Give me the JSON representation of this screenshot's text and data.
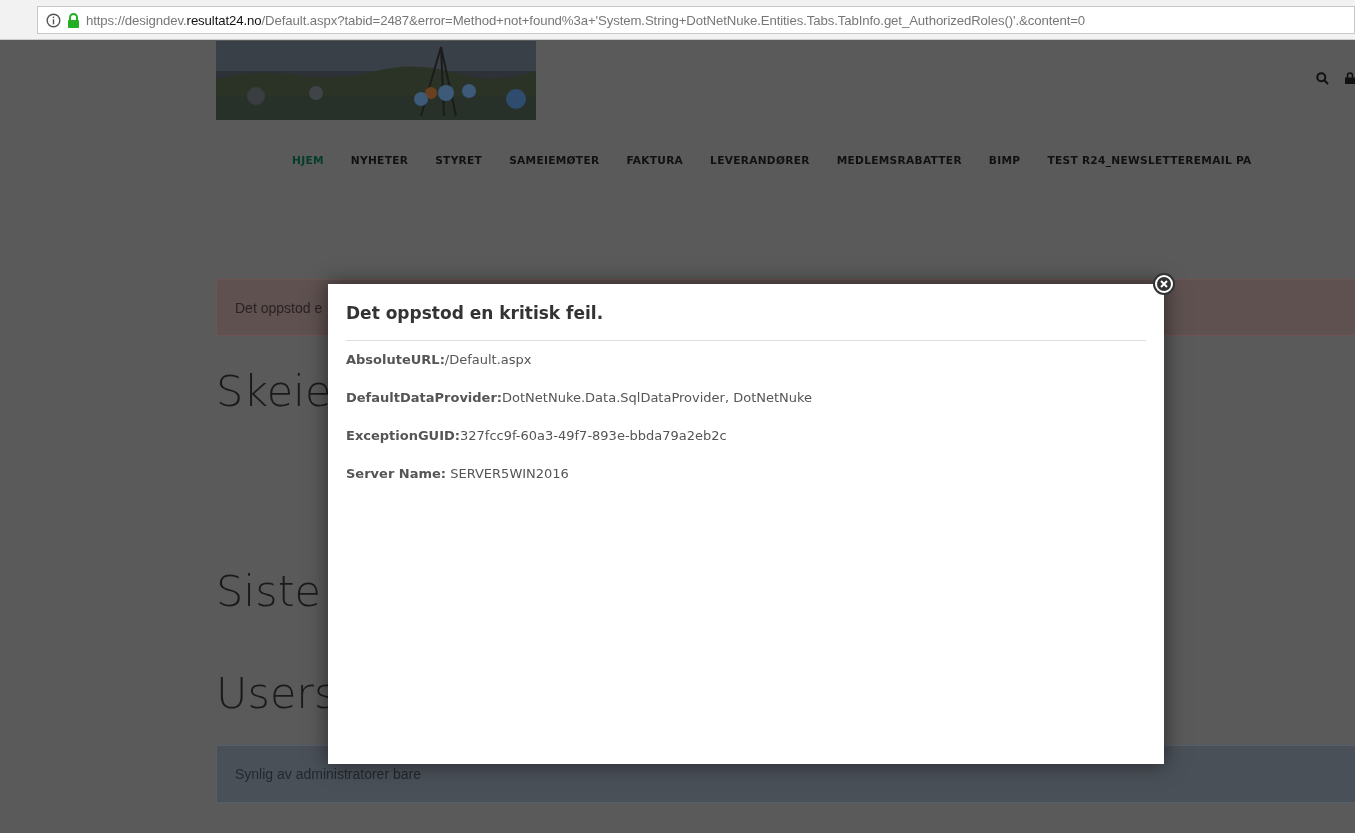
{
  "address_bar": {
    "url_parts": [
      "https://designdev.",
      "resultat24.no",
      "/Default.aspx?tabid=2487&error=Method+not+found%3a+'System.String+DotNetNuke.Entities.Tabs.TabInfo.get_AuthorizedRoles()'.&content=0"
    ],
    "secure": true
  },
  "nav": [
    {
      "label": "HJEM",
      "selected": true
    },
    {
      "label": "NYHETER",
      "selected": false
    },
    {
      "label": "STYRET",
      "selected": false
    },
    {
      "label": "SAMEIEMØTER",
      "selected": false
    },
    {
      "label": "FAKTURA",
      "selected": false
    },
    {
      "label": "LEVERANDØRER",
      "selected": false
    },
    {
      "label": "MEDLEMSRABATTER",
      "selected": false
    },
    {
      "label": "BIMP",
      "selected": false
    },
    {
      "label": "TEST R24_NEWSLETTEREMAIL PA",
      "selected": false
    }
  ],
  "error_alert": "Det oppstod e",
  "headings": [
    "Skeie",
    "Siste",
    "Users"
  ],
  "info_alert": "Synlig av administratorer bare",
  "modal": {
    "title": "Det oppstod en kritisk feil.",
    "lines": [
      "**AbsoluteURL:**/Default.aspx",
      "**DefaultDataProvider:**DotNetNuke.Data.SqlDataProvider, DotNetNuke",
      "**ExceptionGUID:**327fcc9f-60a3-49f7-893e-bbda79a2eb2c",
      "**Server Name:** SERVER5WIN2016"
    ]
  }
}
